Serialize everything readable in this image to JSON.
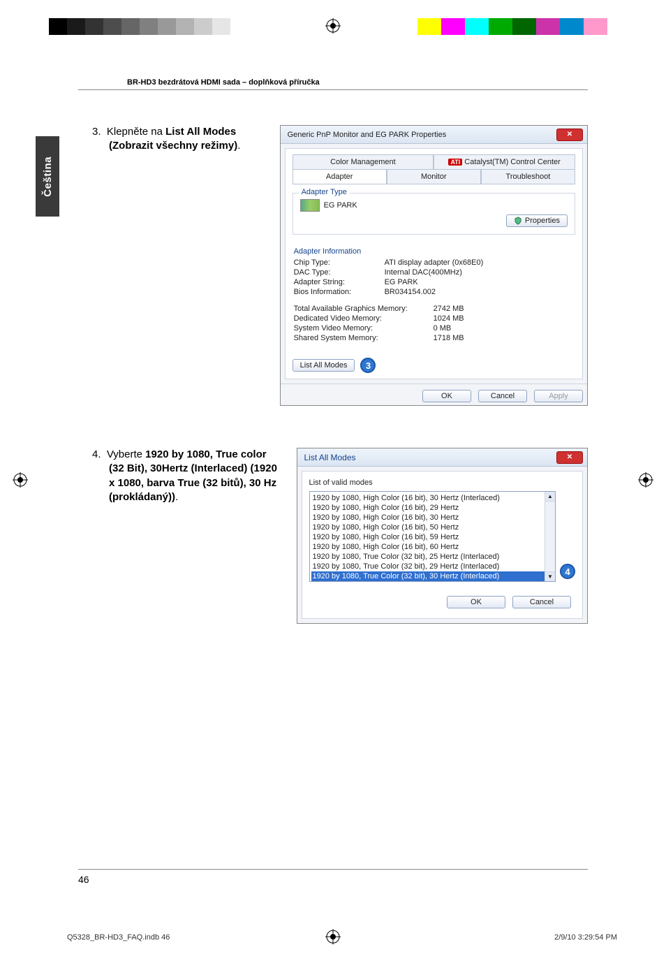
{
  "doc_header": "BR-HD3 bezdrátová HDMI sada – doplňková příručka",
  "sidebar_label": "Čeština",
  "step3": {
    "num": "3.",
    "lead": "Klepněte na ",
    "bold": "List All Modes (Zobrazit všechny režimy)",
    "tail": "."
  },
  "step4": {
    "num": "4.",
    "lead": "Vyberte ",
    "bold": "1920 by 1080, True color (32 Bit), 30Hertz (Interlaced) (1920 x 1080, barva True (32 bitů), 30 Hz (prokládaný))",
    "tail": "."
  },
  "dialog1": {
    "title": "Generic PnP Monitor and EG PARK Properties",
    "tabs_top": {
      "color_mgmt": "Color Management",
      "catalyst": "Catalyst(TM) Control Center",
      "ati": "ATI"
    },
    "tabs_bot": {
      "adapter": "Adapter",
      "monitor": "Monitor",
      "troubleshoot": "Troubleshoot"
    },
    "adapter_type_legend": "Adapter Type",
    "adapter_type_value": "EG PARK",
    "properties_btn": "Properties",
    "adapter_info_legend": "Adapter Information",
    "info": {
      "chip_type_k": "Chip Type:",
      "chip_type_v": "ATI display adapter (0x68E0)",
      "dac_type_k": "DAC Type:",
      "dac_type_v": "Internal DAC(400MHz)",
      "adapter_string_k": "Adapter String:",
      "adapter_string_v": "EG PARK",
      "bios_k": "Bios Information:",
      "bios_v": "BR034154.002",
      "total_mem_k": "Total Available Graphics Memory:",
      "total_mem_v": "2742 MB",
      "ded_mem_k": "Dedicated Video Memory:",
      "ded_mem_v": "1024 MB",
      "sys_mem_k": "System Video Memory:",
      "sys_mem_v": "0 MB",
      "shared_mem_k": "Shared System Memory:",
      "shared_mem_v": "1718 MB"
    },
    "list_all_modes_btn": "List All Modes",
    "callout": "3",
    "ok": "OK",
    "cancel": "Cancel",
    "apply": "Apply"
  },
  "dialog2": {
    "title": "List All Modes",
    "group_label": "List of valid modes",
    "modes": [
      "1920 by 1080, High Color (16 bit), 30 Hertz (Interlaced)",
      "1920 by 1080, High Color (16 bit), 29 Hertz",
      "1920 by 1080, High Color (16 bit), 30 Hertz",
      "1920 by 1080, High Color (16 bit), 50 Hertz",
      "1920 by 1080, High Color (16 bit), 59 Hertz",
      "1920 by 1080, High Color (16 bit), 60 Hertz",
      "1920 by 1080, True Color (32 bit), 25 Hertz (Interlaced)",
      "1920 by 1080, True Color (32 bit), 29 Hertz (Interlaced)",
      "1920 by 1080, True Color (32 bit), 30 Hertz (Interlaced)"
    ],
    "selected_index": 8,
    "callout": "4",
    "ok": "OK",
    "cancel": "Cancel"
  },
  "page_number": "46",
  "print_footer": {
    "file": "Q5328_BR-HD3_FAQ.indb   46",
    "datetime": "2/9/10   3:29:54 PM"
  },
  "color_bar": [
    "#000",
    "#1a1a1a",
    "#333",
    "#4d4d4d",
    "#666",
    "#808080",
    "#999",
    "#b3b3b3",
    "#ccc",
    "#fff",
    "#ff0",
    "#f0f",
    "#0ff",
    "#0c0",
    "#060",
    "#c0f",
    "#09c",
    "#f99",
    "#fff"
  ]
}
